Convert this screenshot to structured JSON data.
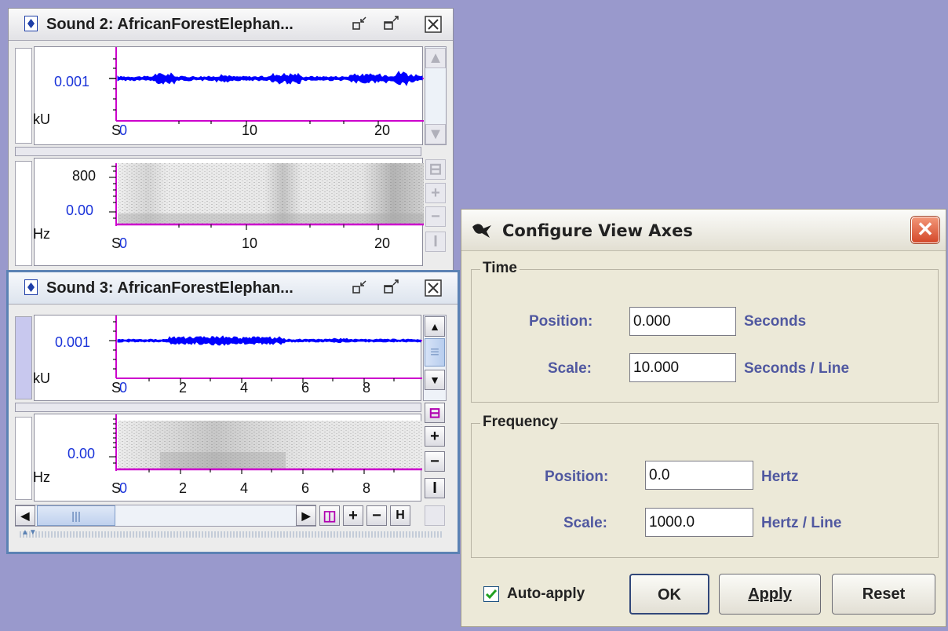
{
  "sound2": {
    "title": "Sound 2: AfricanForestElephan...",
    "waveform": {
      "ytick": "0.001",
      "unit": "kU",
      "xunit": "S",
      "xticks": [
        "0",
        "10",
        "20"
      ]
    },
    "spectrogram": {
      "yticks": [
        "800",
        "0.00"
      ],
      "unit": "Hz",
      "xunit": "S",
      "xticks": [
        "0",
        "10",
        "20"
      ]
    }
  },
  "sound3": {
    "title": "Sound 3: AfricanForestElephan...",
    "waveform": {
      "ytick": "0.001",
      "unit": "kU",
      "xunit": "S",
      "xticks": [
        "0",
        "2",
        "4",
        "6",
        "8"
      ]
    },
    "spectrogram": {
      "ytick": "0.00",
      "unit": "Hz",
      "xunit": "S",
      "xticks": [
        "0",
        "2",
        "4",
        "6",
        "8"
      ]
    }
  },
  "dialog": {
    "title": "Configure View Axes",
    "time": {
      "title": "Time",
      "position_label": "Position:",
      "position_value": "0.000",
      "position_unit": "Seconds",
      "scale_label": "Scale:",
      "scale_value": "10.000",
      "scale_unit": "Seconds / Line"
    },
    "frequency": {
      "title": "Frequency",
      "position_label": "Position:",
      "position_value": "0.0",
      "position_unit": "Hertz",
      "scale_label": "Scale:",
      "scale_value": "1000.0",
      "scale_unit": "Hertz / Line"
    },
    "auto_apply_label": "Auto-apply",
    "auto_apply_checked": true,
    "ok_label": "OK",
    "apply_label": "Apply",
    "reset_label": "Reset"
  },
  "colors": {
    "desktop": "#9999cc",
    "axis_magenta": "#cc00cc",
    "signal_blue": "#0000ff",
    "label_blue": "#1a33d9",
    "active_border": "#5b82b4"
  }
}
